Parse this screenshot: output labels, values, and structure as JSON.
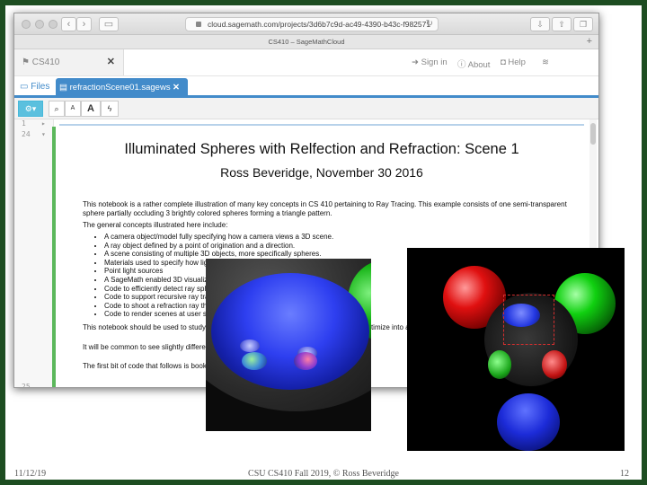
{
  "browser": {
    "url": "cloud.sagemath.com/projects/3d6b7c9d-ac49-4390-b43c-f982571",
    "window_title": "CS410 – SageMathCloud"
  },
  "smc": {
    "project_tab": "CS410",
    "sign_in": "Sign in",
    "about": "About",
    "help": "Help",
    "files_link": "Files",
    "file_tab": "refractionScene01.sagews"
  },
  "toolbar": {
    "font_small": "A",
    "font_large": "A"
  },
  "gutter": {
    "line1": "1",
    "line2": "24",
    "line3": "25"
  },
  "doc": {
    "title": "Illuminated Spheres with Relfection and Refraction: Scene 1",
    "author": "Ross Beveridge, November 30 2016",
    "intro": "This notebook is a rather complete illustration of many key concepts in CS 410 pertaining to Ray Tracing.  This example consists of one semi-transparent sphere partially occluding 3 brightly colored spheres forming a triangle pattern.",
    "concepts_header": "The general concepts illustrated here include:",
    "bullets": [
      "A camera object/model fully specifying how a camera views a 3D scene.",
      "A ray object defined by a point of origination and a direction.",
      "A scene consisting of multiple 3D objects, more specifically spheres.",
      "Materials used to specify how light interacts with an object's surface.",
      "Point light sources",
      "A SageMath enabled 3D visualization",
      "Code to efficiently detect ray sphere",
      "Code to support recursive ray tracin",
      "Code to shoot a refraction ray throu",
      "Code to render scenes at user spec"
    ],
    "para2": "This notebook should be used to study and                                                                                  er underst work.  The design is by no means optimize                                                                                    into a single",
    "para3": "It will be common to see slightly different v                                                                                  ere that act to produce a different scene.",
    "para4": "The first bit of code that follows is book ke                                                                                    ead on bel"
  },
  "footer": {
    "date": "11/12/19",
    "course": "CSU CS410 Fall 2019, © Ross Beveridge",
    "page": "12"
  },
  "colors": {
    "slide_border": "#1d4d21",
    "accent_blue": "#428bca",
    "cell_green": "#5cb85c",
    "zoom_box": "#d32f2f"
  },
  "icons": [
    "gear-icon",
    "search-icon",
    "lightning-icon",
    "folder-icon",
    "file-icon",
    "sign-in-icon",
    "question-icon",
    "camera-icon",
    "wifi-icon",
    "close-icon",
    "lock-icon",
    "reload-icon",
    "plus-icon"
  ]
}
